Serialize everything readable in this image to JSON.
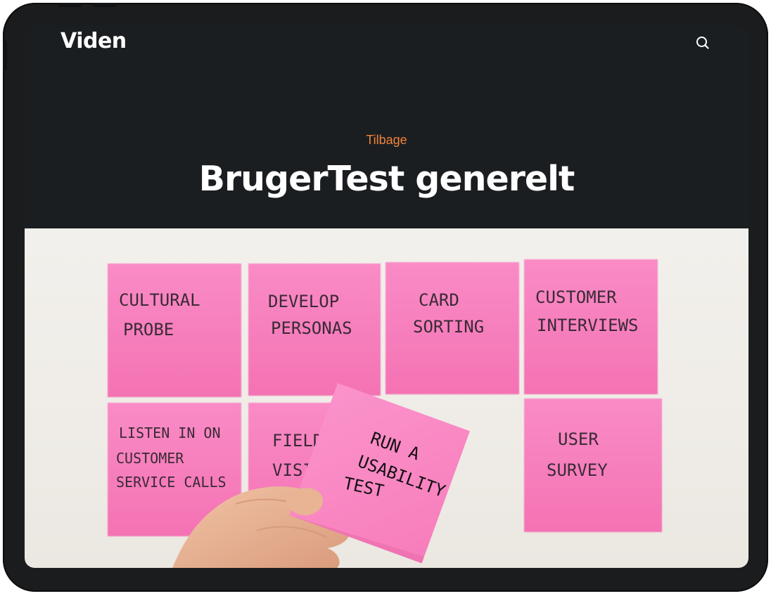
{
  "app": {
    "logo": "Viden"
  },
  "header": {
    "search_icon": "search-icon",
    "back_link": "Tilbage",
    "title": "BrugerTest generelt"
  },
  "colors": {
    "frame": "#1b1c1e",
    "header_bg": "#1b1e21",
    "accent": "#f0843a",
    "note_pink": "#f77fbd",
    "hero_bg": "#f0eee9"
  },
  "hero": {
    "notes": [
      {
        "line1": "CULTURAL",
        "line2": "PROBE"
      },
      {
        "line1": "DEVELOP",
        "line2": "PERSONAS"
      },
      {
        "line1": "CARD",
        "line2": "SORTING"
      },
      {
        "line1": "CUSTOMER",
        "line2": "INTERVIEWS"
      },
      {
        "line1": "LISTEN IN ON",
        "line2": "CUSTOMER",
        "line3": "SERVICE CALLS"
      },
      {
        "line1": "FIELD",
        "line2": "VISITS"
      },
      {
        "line1": "USER",
        "line2": "SURVEY"
      }
    ],
    "held_note": {
      "line1": "RUN A",
      "line2": "USABILITY",
      "line3": "TEST"
    }
  }
}
